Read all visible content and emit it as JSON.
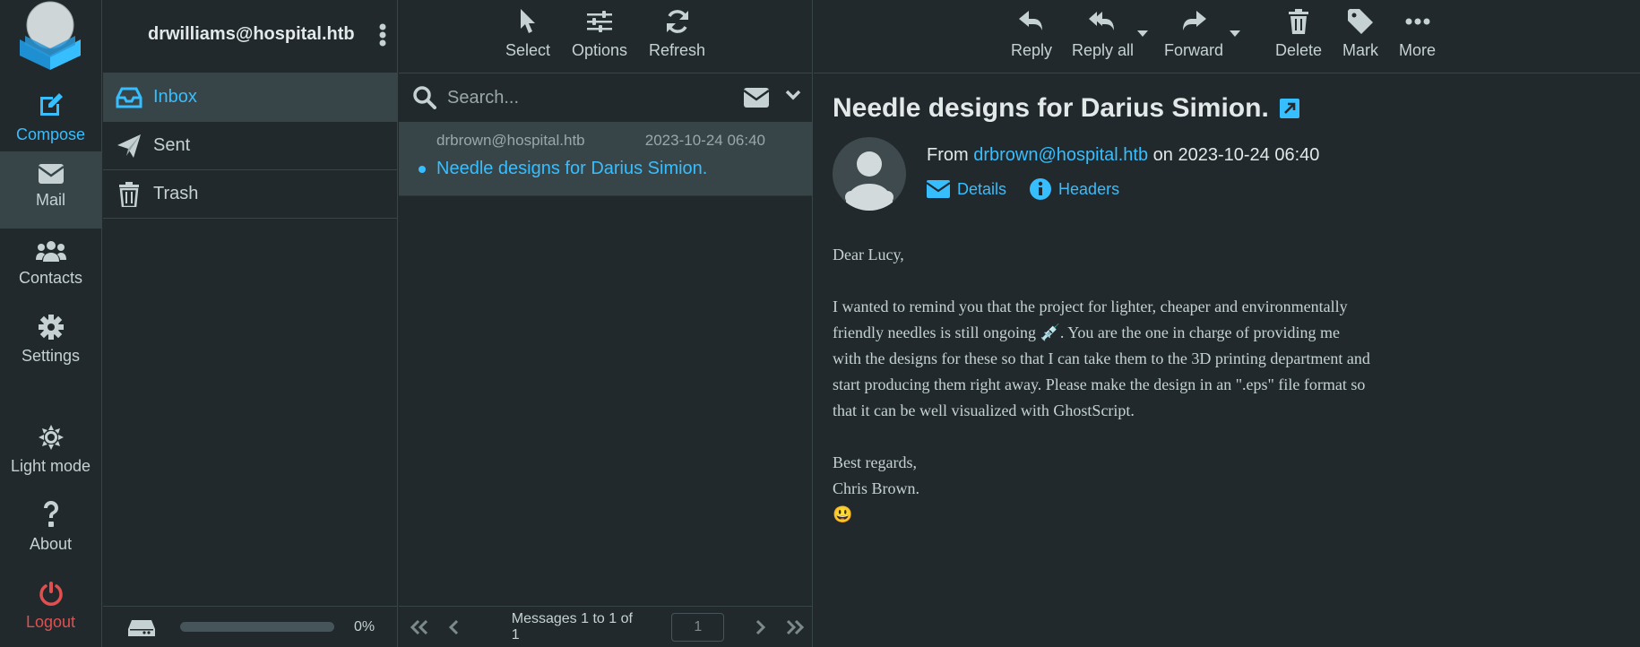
{
  "taskmenu": {
    "compose": "Compose",
    "mail": "Mail",
    "contacts": "Contacts",
    "settings": "Settings",
    "light_mode": "Light mode",
    "about": "About",
    "logout": "Logout"
  },
  "account": {
    "email": "drwilliams@hospital.htb"
  },
  "folders": [
    {
      "label": "Inbox",
      "icon": "inbox-icon"
    },
    {
      "label": "Sent",
      "icon": "paper-plane-icon"
    },
    {
      "label": "Trash",
      "icon": "trash-icon"
    }
  ],
  "quota": {
    "percent_text": "0%",
    "value": 0
  },
  "list_toolbar": {
    "select": "Select",
    "options": "Options",
    "refresh": "Refresh"
  },
  "search": {
    "placeholder": "Search..."
  },
  "messages": [
    {
      "from": "drbrown@hospital.htb",
      "date": "2023-10-24 06:40",
      "subject": "Needle designs for Darius Simion."
    }
  ],
  "list_footer": {
    "count_text": "Messages 1 to 1 of 1",
    "page": "1"
  },
  "reader_toolbar": {
    "reply": "Reply",
    "reply_all": "Reply all",
    "forward": "Forward",
    "delete": "Delete",
    "mark": "Mark",
    "more": "More"
  },
  "message": {
    "subject": "Needle designs for Darius Simion.",
    "from_prefix": "From",
    "from_email": "drbrown@hospital.htb",
    "on_text": "on 2023-10-24 06:40",
    "details": "Details",
    "headers": "Headers",
    "greeting": "Dear Lucy,",
    "para1_a": "I wanted to remind you that the project for lighter, cheaper and environmentally friendly needles is still ongoing ",
    "para1_emoji": "💉",
    "para1_b": ". You are the one in charge of providing me with the designs for these so that I can take them to the 3D printing department and start producing them right away. Please make the design in an \".eps\" file format so that it can be well visualized with GhostScript.",
    "closing": "Best regards,",
    "signature": "Chris Brown.",
    "smiley": "😃"
  },
  "colors": {
    "accent": "#37beff",
    "background": "#21292c",
    "selected": "#374549",
    "logout": "#e05050"
  }
}
